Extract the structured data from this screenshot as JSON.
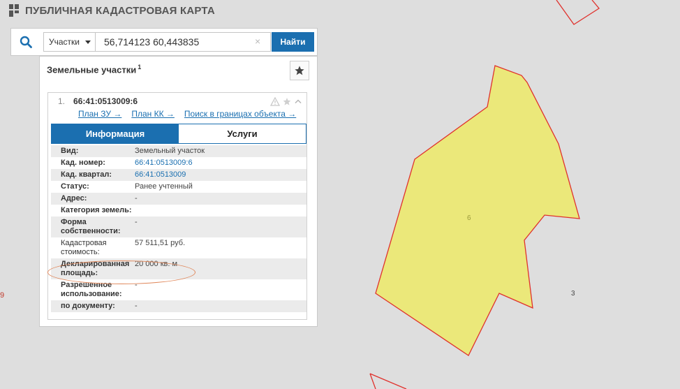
{
  "app": {
    "title": "ПУБЛИЧНАЯ КАДАСТРОВАЯ КАРТА"
  },
  "search": {
    "type_selected": "Участки",
    "query_value": "56,714123 60,443835",
    "clear_symbol": "×",
    "find_label": "Найти"
  },
  "panel": {
    "title": "Земельные участки",
    "count": "1",
    "item": {
      "number": "1.",
      "cadastral_number": "66:41:0513009:6",
      "links": [
        "План ЗУ →",
        "План КК →",
        "Поиск в границах объекта →"
      ],
      "tabs": [
        "Информация",
        "Услуги"
      ],
      "rows": [
        {
          "label": "Вид:",
          "value": "Земельный участок"
        },
        {
          "label": "Кад. номер:",
          "value": "66:41:0513009:6"
        },
        {
          "label": "Кад. квартал:",
          "value": "66:41:0513009"
        },
        {
          "label": "Статус:",
          "value": "Ранее учтенный"
        },
        {
          "label": "Адрес:",
          "value": "-"
        },
        {
          "label": "Категория земель:",
          "value": ""
        },
        {
          "label": "Форма собственности:",
          "value": "-"
        },
        {
          "label": "Кадастровая стоимость:",
          "value": "57 511,51 руб."
        },
        {
          "label": "Декларированная площадь:",
          "value": "20 000 кв. м"
        },
        {
          "label": "Разрешенное использование:",
          "value": "-"
        },
        {
          "label": "по документу:",
          "value": "-"
        }
      ]
    }
  },
  "map": {
    "parcel_label": "6",
    "neighbor_label": "3",
    "edge_label": "9",
    "parcel_fill": "#ebe87a",
    "parcel_stroke": "#e0312c",
    "background": "#dedede"
  },
  "colors": {
    "accent": "#1b6fb0",
    "link": "#1a6fb0"
  }
}
